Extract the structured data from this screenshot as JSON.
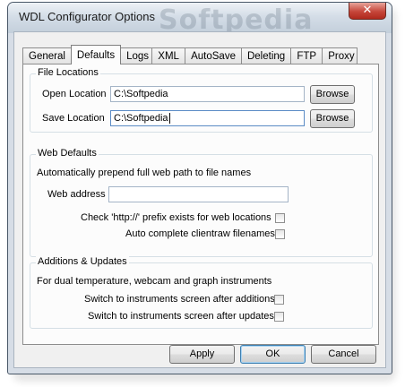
{
  "window": {
    "title": "WDL Configurator Options",
    "watermark": "Softpedia",
    "close_icon": "close-icon"
  },
  "tabs": [
    {
      "label": "General",
      "active": false
    },
    {
      "label": "Defaults",
      "active": true
    },
    {
      "label": "Logs",
      "active": false
    },
    {
      "label": "XML",
      "active": false
    },
    {
      "label": "AutoSave",
      "active": false
    },
    {
      "label": "Deleting",
      "active": false
    },
    {
      "label": "FTP",
      "active": false
    },
    {
      "label": "Proxy",
      "active": false
    }
  ],
  "file_locations": {
    "title": "File Locations",
    "open_label": "Open Location",
    "open_value": "C:\\Softpedia",
    "save_label": "Save Location",
    "save_value": "C:\\Softpedia",
    "browse_label": "Browse"
  },
  "web_defaults": {
    "title": "Web Defaults",
    "description": "Automatically prepend full web path to file names",
    "address_label": "Web address",
    "address_value": "",
    "check_http_label": "Check 'http://' prefix exists for web locations",
    "check_http_checked": false,
    "auto_complete_label": "Auto complete clientraw filenames",
    "auto_complete_checked": false
  },
  "additions": {
    "title": "Additions & Updates",
    "description": "For dual temperature, webcam and graph instruments",
    "after_additions_label": "Switch to instruments screen after additions",
    "after_additions_checked": false,
    "after_updates_label": "Switch to instruments screen after updates",
    "after_updates_checked": false
  },
  "buttons": {
    "apply": "Apply",
    "ok": "OK",
    "cancel": "Cancel"
  }
}
